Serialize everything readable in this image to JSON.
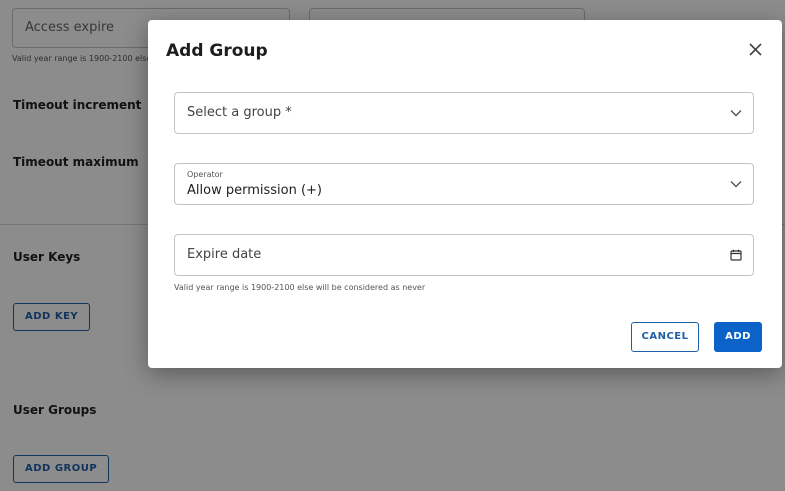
{
  "background": {
    "access_expire_placeholder": "Access expire",
    "access_expire_helper": "Valid year range is 1900-2100 else will be considered as never",
    "timeout_increment_label": "Timeout increment",
    "timeout_maximum_label": "Timeout maximum",
    "user_keys_label": "User Keys",
    "add_key_button": "ADD KEY",
    "user_groups_label": "User Groups",
    "add_group_button": "ADD GROUP"
  },
  "dialog": {
    "title": "Add Group",
    "close_icon": "close-icon",
    "group_select": {
      "placeholder": "Select a group *",
      "icon": "chevron-down-icon"
    },
    "operator_select": {
      "label": "Operator",
      "value": "Allow permission (+)",
      "icon": "chevron-down-icon"
    },
    "expire_date": {
      "placeholder": "Expire date",
      "icon": "calendar-icon"
    },
    "helper_text": "Valid year range is 1900-2100 else will be considered as never",
    "cancel_button": "CANCEL",
    "add_button": "ADD"
  },
  "colors": {
    "primary": "#0b63c9",
    "outline": "#1f5fa8",
    "overlay": "rgba(0,0,0,0.45)"
  }
}
